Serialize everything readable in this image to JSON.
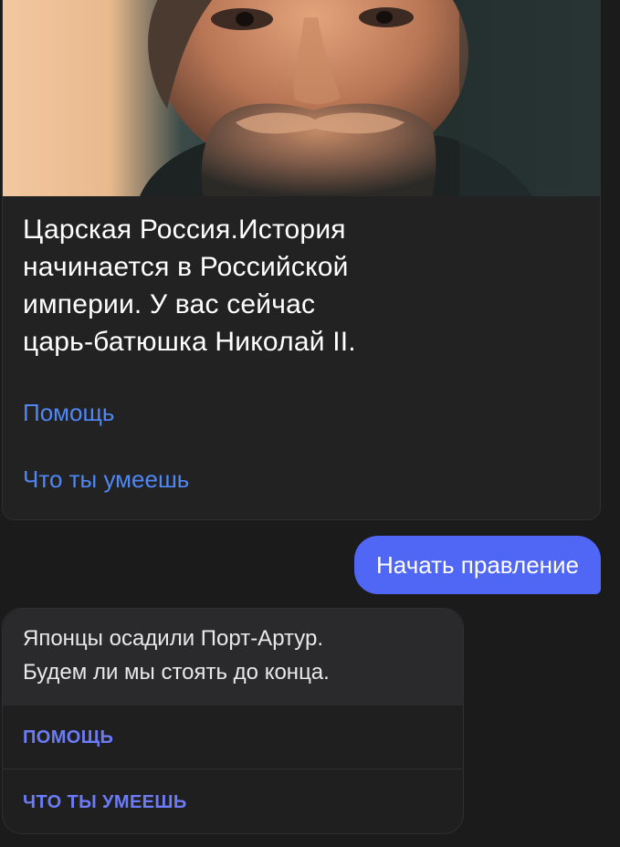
{
  "card1": {
    "image": "portrait-photo",
    "title_lines": [
      "Царская Россия.История",
      "начинается в Российской",
      "империи. У вас сейчас",
      "царь-батюшка Николай II."
    ],
    "links": [
      "Помощь",
      "Что ты умеешь"
    ]
  },
  "user_message": "Начать правление",
  "card2": {
    "text_lines": [
      "Японцы осадили Порт-Артур.",
      "Будем ли мы стоять до конца."
    ],
    "buttons": [
      "ПОМОЩЬ",
      "ЧТО ТЫ УМЕЕШЬ"
    ]
  },
  "colors": {
    "background": "#1b1b1c",
    "card": "#222223",
    "link": "#4f87f4",
    "user_bubble": "#5066f5",
    "button_text": "#6c7cf7"
  }
}
